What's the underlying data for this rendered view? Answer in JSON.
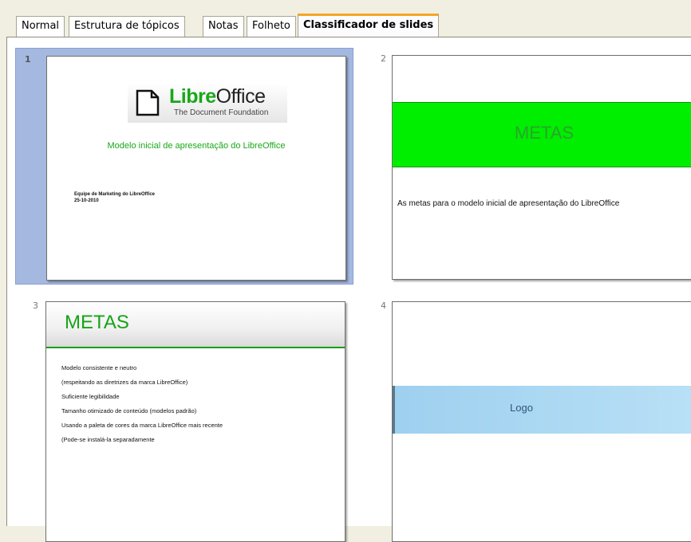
{
  "tabs": [
    {
      "label": "Normal"
    },
    {
      "label": "Estrutura de tópicos"
    },
    {
      "label": "Notas"
    },
    {
      "label": "Folheto"
    },
    {
      "label": "Classificador de slides"
    }
  ],
  "active_tab": "Classificador de slides",
  "slides": [
    {
      "number": "1",
      "selected": true,
      "logo_text_bold": "Libre",
      "logo_text_regular": "Office",
      "logo_subtitle": "The Document Foundation",
      "title": "Modelo inicial de apresentação do LibreOffice",
      "author": "Equipe de Marketing do LibreOffice",
      "date": "25-10-2010"
    },
    {
      "number": "2",
      "band_title": "METAS",
      "band_color": "#00ee00",
      "body": "As metas para o modelo inicial de apresentação do LibreOffice"
    },
    {
      "number": "3",
      "title": "METAS",
      "accent_color": "#17a317",
      "bullets": [
        "Modelo consistente e neutro",
        "(respeitando as diretrizes da marca LibreOffice)",
        "Suficiente legibilidade",
        "Tamanho otimizado de conteúdo (modelos padrão)",
        "Usando a paleta de cores da marca LibreOffice mais recente",
        "(Pode-se instalá-la separadamente"
      ]
    },
    {
      "number": "4",
      "band_label": "Logo",
      "band_color": "#9ed0ef"
    }
  ]
}
